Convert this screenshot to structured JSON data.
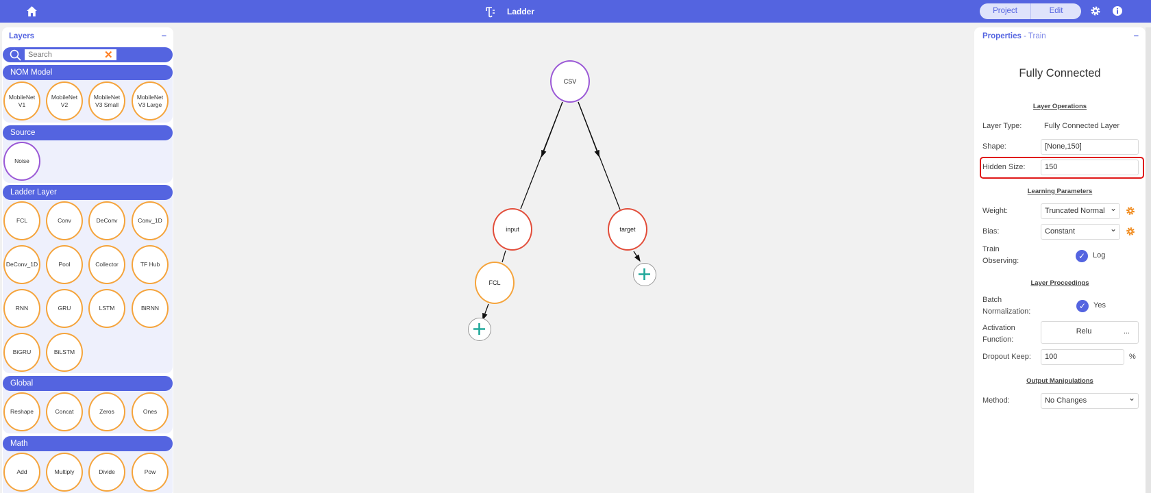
{
  "topbar": {
    "title": "Ladder",
    "project_label": "Project",
    "edit_label": "Edit"
  },
  "layers_panel": {
    "title": "Layers",
    "minimize": "–",
    "search_placeholder": "Search",
    "categories": [
      {
        "name": "NOM Model",
        "items": [
          "MobileNet V1",
          "MobileNet V2",
          "MobileNet V3 Small",
          "MobileNet V3 Large"
        ]
      },
      {
        "name": "Source",
        "items": [
          "Noise"
        ]
      },
      {
        "name": "Ladder Layer",
        "items": [
          "FCL",
          "Conv",
          "DeConv",
          "Conv_1D",
          "DeConv_1D",
          "Pool",
          "Collector",
          "TF Hub",
          "RNN",
          "GRU",
          "LSTM",
          "BiRNN",
          "BiGRU",
          "BiLSTM"
        ]
      },
      {
        "name": "Global",
        "items": [
          "Reshape",
          "Concat",
          "Zeros",
          "Ones"
        ]
      },
      {
        "name": "Math",
        "items": [
          "Add",
          "Multiply",
          "Divide",
          "Pow"
        ]
      }
    ]
  },
  "graph": {
    "nodes": [
      "CSV",
      "input",
      "target",
      "FCL"
    ]
  },
  "properties": {
    "title": "Properties",
    "mode": "- Train",
    "minimize": "–",
    "layer_title": "Fully Connected",
    "sections": {
      "layer_operations": "Layer Operations",
      "learning_parameters": "Learning Parameters",
      "layer_proceedings": "Layer Proceedings",
      "output_manipulations": "Output Manipulations"
    },
    "layer_type_label": "Layer Type:",
    "layer_type_value": "Fully Connected Layer",
    "shape_label": "Shape:",
    "shape_value": "[None,150]",
    "hidden_size_label": "Hidden Size:",
    "hidden_size_value": "150",
    "weight_label": "Weight:",
    "weight_value": "Truncated Normal",
    "bias_label": "Bias:",
    "bias_value": "Constant",
    "train_observing_label": "Train Observing:",
    "train_observing_value": "Log",
    "batch_norm_label": "Batch Normalization:",
    "batch_norm_value": "Yes",
    "activation_label": "Activation Function:",
    "activation_value": "Relu",
    "activation_more": "...",
    "dropout_label": "Dropout Keep:",
    "dropout_value": "100",
    "dropout_unit": "%",
    "method_label": "Method:",
    "method_value": "No Changes"
  }
}
